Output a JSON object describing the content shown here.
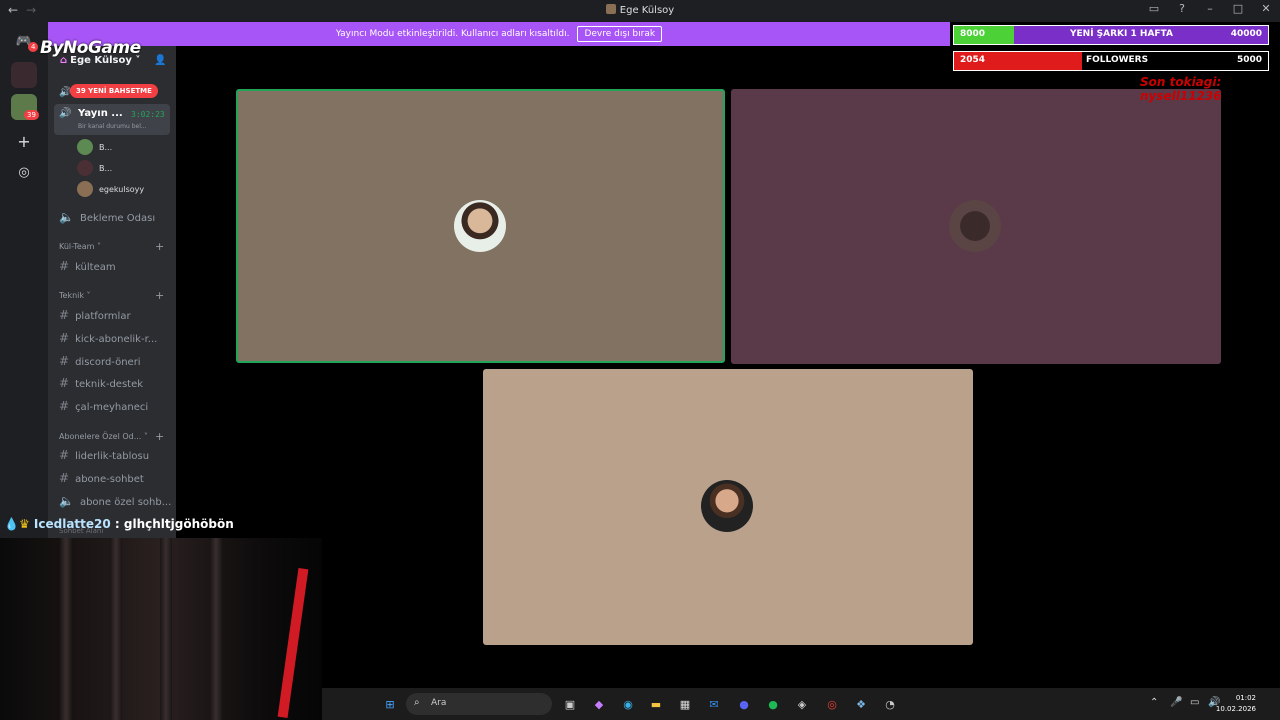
{
  "window": {
    "title": "Ege Külsoy"
  },
  "banner": {
    "text": "Yayıncı Modu etkinleştirildi. Kullanıcı adları kısaltıldı.",
    "button": "Devre dışı bırak"
  },
  "logo": "ByNoGame",
  "server": {
    "name": "Ege Külsoy",
    "mention_pill": "39 YENİ BAHSETME"
  },
  "guild_badges": {
    "discord": "4",
    "server": "39"
  },
  "voice": {
    "active_channel": "Yayın ...",
    "timer": "3:02:23",
    "status": "Bir kanal durumu bel...",
    "users": [
      "B...",
      "B...",
      "egekulsoyy"
    ],
    "waiting": "Bekleme Odası"
  },
  "categories": [
    {
      "name": "Kül-Team",
      "channels": [
        "külteam"
      ]
    },
    {
      "name": "Teknik",
      "channels": [
        "platformlar",
        "kick-abonelik-r...",
        "discord-öneri",
        "teknik-destek",
        "çal-meyhaneci"
      ]
    },
    {
      "name": "Abonelere Özel Od...",
      "channels": [
        "liderlik-tablosu",
        "abone-sohbet",
        "abone özel sohb..."
      ]
    }
  ],
  "hidden_label": "Sohbet Alanı",
  "overlay": {
    "bar1": {
      "current": "8000",
      "label": "YENİ ŞARKI 1 HAFTA",
      "goal": "40000",
      "progress": 0.2
    },
    "bar2": {
      "current": "2054",
      "label": "FOLLOWERS",
      "goal": "5000",
      "progress": 0.41
    },
    "last_tip": "Son tokiagi: nysell11236"
  },
  "chat": {
    "user": "Icedlatte20",
    "message": ": glhçhltjgöhöbön"
  },
  "taskbar": {
    "search": "Ara",
    "time": "01:02",
    "date": "10.02.2026"
  },
  "colors": {
    "banner": "#a855f7",
    "tile1": "#827262",
    "tile2": "#5a3a49",
    "tile3": "#b9a18c",
    "speaking": "#23a559"
  }
}
